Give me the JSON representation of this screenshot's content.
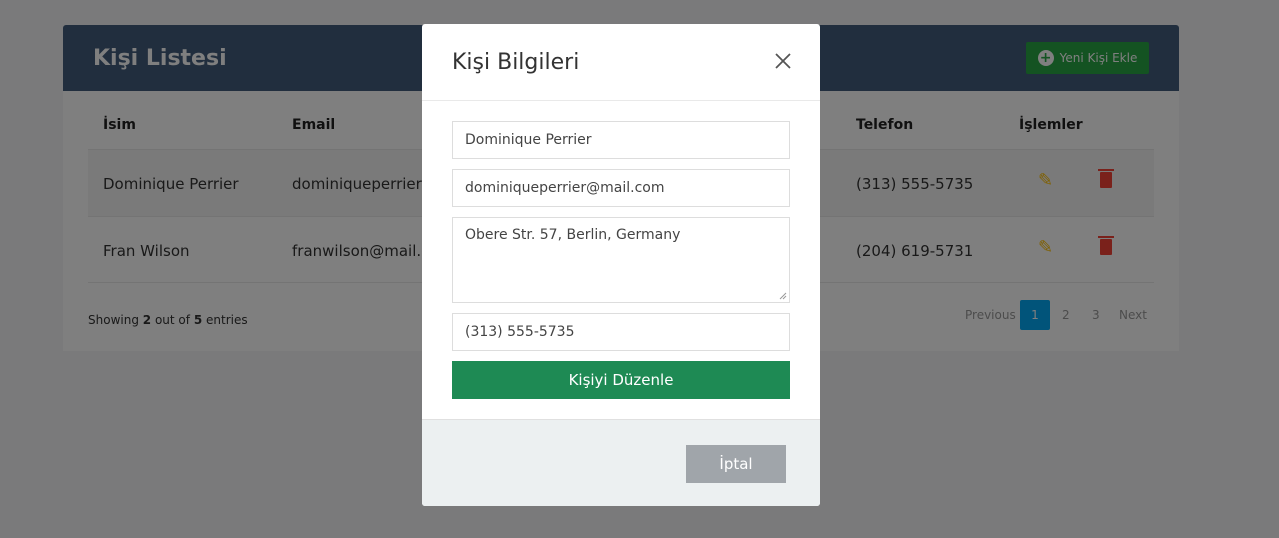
{
  "header": {
    "title": "Kişi Listesi",
    "add_label": "Yeni Kişi Ekle"
  },
  "table": {
    "columns": [
      "İsim",
      "Email",
      "Telefon",
      "İşlemler"
    ],
    "rows": [
      {
        "name": "Dominique Perrier",
        "email": "dominiqueperrier@",
        "phone": "(313) 555-5735"
      },
      {
        "name": "Fran Wilson",
        "email": "franwilson@mail.co",
        "phone": "(204) 619-5731"
      }
    ]
  },
  "footer": {
    "showing_prefix": "Showing",
    "shown": "2",
    "out_of": "out of",
    "total": "5",
    "entries": "entries"
  },
  "pagination": {
    "previous": "Previous",
    "pages": [
      "1",
      "2",
      "3"
    ],
    "active": "1",
    "next": "Next"
  },
  "modal": {
    "title": "Kişi Bilgileri",
    "name_value": "Dominique Perrier",
    "email_value": "dominiqueperrier@mail.com",
    "address_value": "Obere Str. 57, Berlin, Germany",
    "phone_value": "(313) 555-5735",
    "submit_label": "Kişiyi Düzenle",
    "cancel_label": "İptal"
  },
  "icons": {
    "add": "plus-circle-icon",
    "edit": "pencil-icon",
    "delete": "trash-icon",
    "close": "close-icon"
  },
  "colors": {
    "header": "#435d7d",
    "add": "#28a745",
    "edit": "#ffc107",
    "delete": "#f44336",
    "submit": "#1e8a54",
    "cancel": "#a0a5aa",
    "page_active": "#03a9f4"
  }
}
